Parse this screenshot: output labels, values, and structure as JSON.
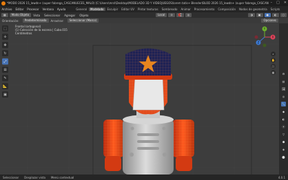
{
  "window": {
    "title": "*MODO 2026 15_lewdn+ (super fabrega_CASCANUECES_MALO) [C:\\Users\\mrsl\\Desktop\\MODELADO 3D Y VIDEOJUEGOS\\lorem tatis+ Blender\\BLOD 2026 15_lewdn+ (super fabrega_CASCANUECES_MALO).blend] - Blender 4.0.1",
    "controls": [
      "–",
      "□",
      "✕"
    ]
  },
  "menubar": {
    "items": [
      "Archivo",
      "Editar",
      "Procesar",
      "Ventana",
      "Ayuda"
    ],
    "workspaces": [
      "General",
      "Modelado",
      "Esculpir",
      "Editar UV",
      "Pintar texturas",
      "Sombreado",
      "Animar",
      "Procesamiento",
      "Composición",
      "Nodos de geometría",
      "Scripts"
    ],
    "active_workspace": "Modelado"
  },
  "header": {
    "mode": "Modo Objeto",
    "menus": [
      "Vista",
      "Seleccionar",
      "Agregar",
      "Objeto"
    ],
    "transform": "Local",
    "options": "Opciones"
  },
  "tool_header": {
    "orientation_label": "Orientación:",
    "orientation_value": "Predeterminada",
    "drag_label": "Arrastrar:",
    "drag_value": "Seleccionar (Marco)"
  },
  "viewport": {
    "overlay": {
      "line1": "Frontal (ortogonal)",
      "line2": "(1) Colección de la escena | Cubo.015",
      "line3": "Centímetros"
    }
  },
  "toolbar": {
    "tools": [
      {
        "name": "select-box",
        "glyph": "⬚"
      },
      {
        "name": "cursor",
        "glyph": "✛"
      },
      {
        "name": "move",
        "glyph": "✥"
      },
      {
        "name": "rotate",
        "glyph": "↻"
      },
      {
        "name": "scale",
        "glyph": "⤢"
      },
      {
        "name": "transform",
        "glyph": "⊞"
      },
      {
        "name": "annotate",
        "glyph": "✎"
      },
      {
        "name": "measure",
        "glyph": "📐"
      },
      {
        "name": "add-cube",
        "glyph": "▣"
      }
    ],
    "active_tool": "scale"
  },
  "gizmo": {
    "x": "X",
    "y": "Y",
    "z": "Z"
  },
  "navigation": [
    "⌕",
    "✋",
    "🎥",
    "▦"
  ],
  "properties_tabs": [
    "⚙",
    "▤",
    "🖼",
    "◎",
    "🔧",
    "◆",
    "◐",
    "⦿",
    "▽",
    "⬢",
    "◈",
    "⬤"
  ],
  "statusbar": {
    "items": [
      "Seleccionar",
      "Desplazar vista",
      "Menú contextual"
    ],
    "right": "4.0.1"
  },
  "colors": {
    "accent": "#4772b3",
    "cap": "#1f2255",
    "star": "#e8851f",
    "hair": "#d84a1f",
    "body": "#bfbfbf"
  }
}
